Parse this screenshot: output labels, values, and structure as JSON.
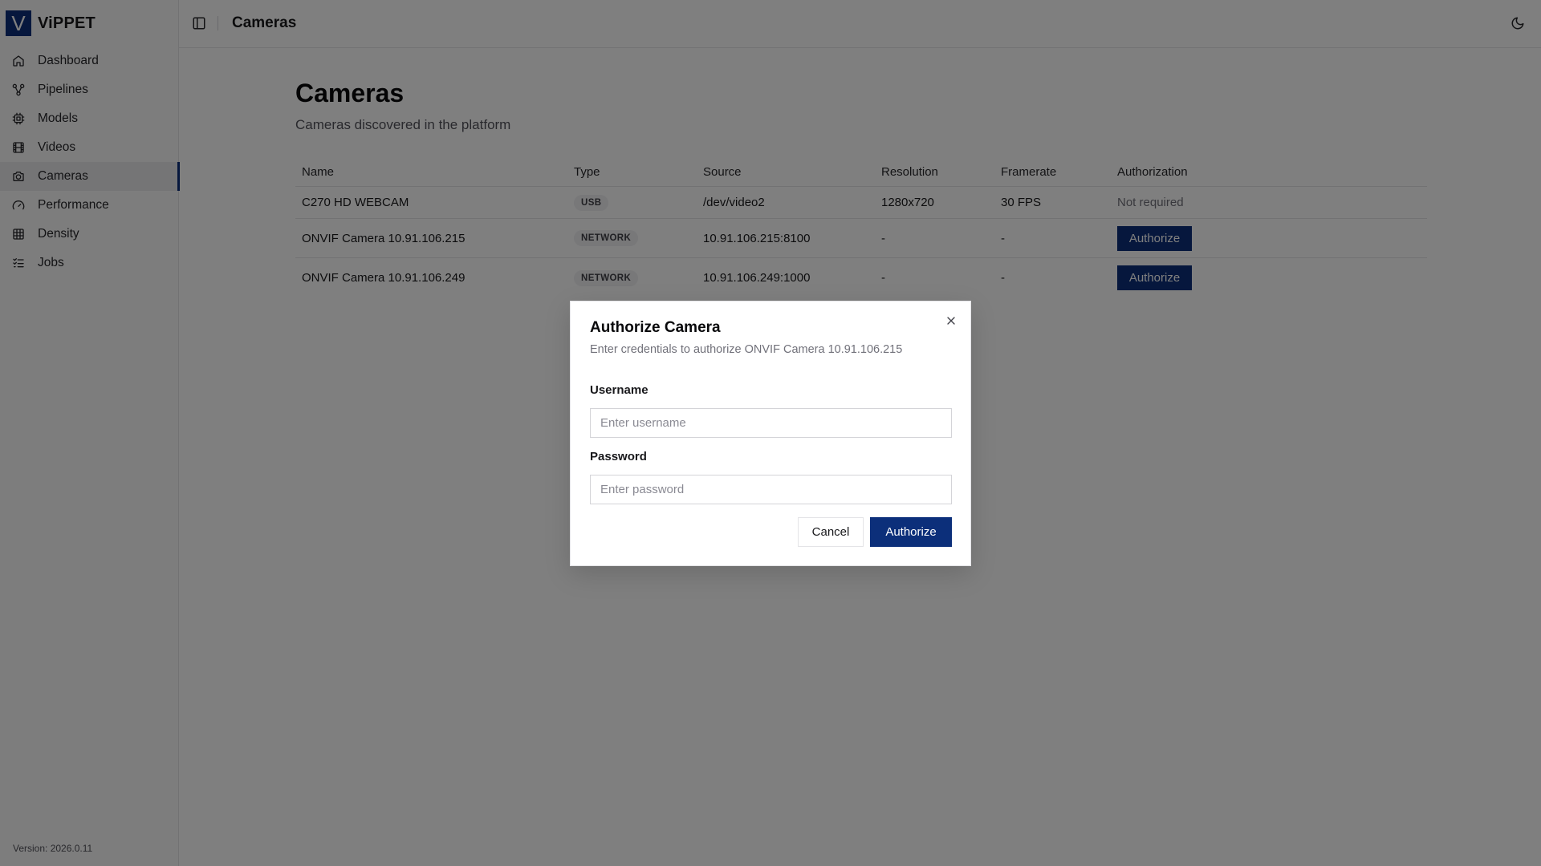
{
  "app": {
    "logo_letter": "V",
    "name": "ViPPET",
    "version": "Version: 2026.0.11"
  },
  "colors": {
    "accent": "#0c2f7a",
    "overlay": "rgba(0,0,0,0.5)"
  },
  "sidebar": {
    "items": [
      {
        "label": "Dashboard",
        "icon": "home-icon",
        "active": false
      },
      {
        "label": "Pipelines",
        "icon": "workflow-icon",
        "active": false
      },
      {
        "label": "Models",
        "icon": "chip-icon",
        "active": false
      },
      {
        "label": "Videos",
        "icon": "film-icon",
        "active": false
      },
      {
        "label": "Cameras",
        "icon": "camera-icon",
        "active": true
      },
      {
        "label": "Performance",
        "icon": "gauge-icon",
        "active": false
      },
      {
        "label": "Density",
        "icon": "grid-icon",
        "active": false
      },
      {
        "label": "Jobs",
        "icon": "list-checks-icon",
        "active": false
      }
    ]
  },
  "header": {
    "title": "Cameras"
  },
  "main": {
    "title": "Cameras",
    "subtitle": "Cameras discovered in the platform",
    "table": {
      "columns": [
        "Name",
        "Type",
        "Source",
        "Resolution",
        "Framerate",
        "Authorization"
      ],
      "rows": [
        {
          "name": "C270 HD WEBCAM",
          "type": "USB",
          "source": "/dev/video2",
          "resolution": "1280x720",
          "framerate": "30 FPS",
          "authorization": "Not required"
        },
        {
          "name": "ONVIF Camera 10.91.106.215",
          "type": "NETWORK",
          "source": "10.91.106.215:8100",
          "resolution": "-",
          "framerate": "-",
          "authorization": "Authorize"
        },
        {
          "name": "ONVIF Camera 10.91.106.249",
          "type": "NETWORK",
          "source": "10.91.106.249:1000",
          "resolution": "-",
          "framerate": "-",
          "authorization": "Authorize"
        }
      ]
    }
  },
  "dialog": {
    "title": "Authorize Camera",
    "description": "Enter credentials to authorize ONVIF Camera 10.91.106.215",
    "username_label": "Username",
    "username_placeholder": "Enter username",
    "username_value": "",
    "password_label": "Password",
    "password_placeholder": "Enter password",
    "password_value": "",
    "cancel_label": "Cancel",
    "authorize_label": "Authorize"
  }
}
